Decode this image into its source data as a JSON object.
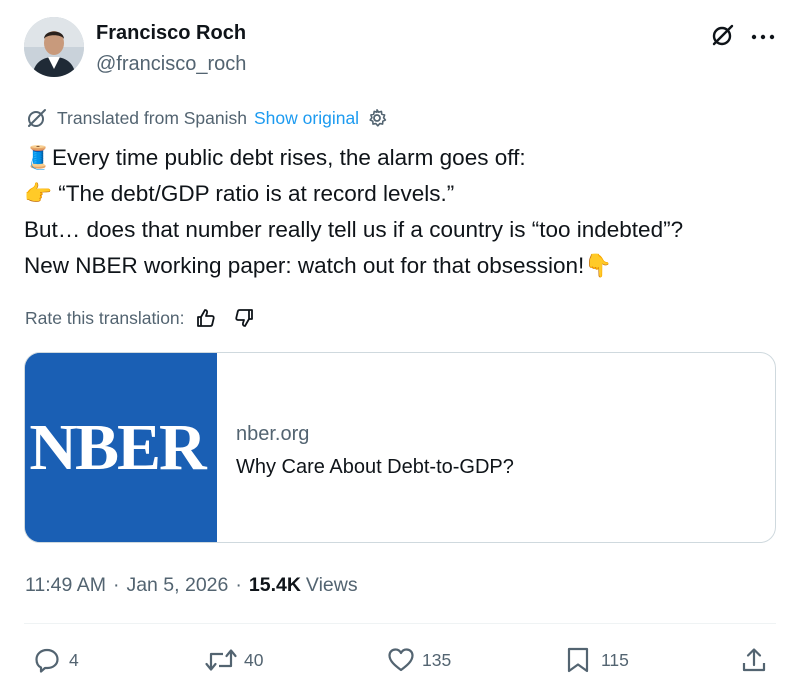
{
  "author": {
    "name": "Francisco Roch",
    "handle": "@francisco_roch"
  },
  "header_icons": [
    "grok-icon",
    "more-icon"
  ],
  "translation": {
    "label": "Translated from Spanish",
    "show_original": "Show original"
  },
  "tweet": {
    "lines": [
      {
        "emoji": "🧵",
        "text": "Every time public debt rises, the alarm goes off:"
      },
      {
        "emoji": "👉",
        "text": " “The debt/GDP ratio is at record levels.”"
      },
      {
        "text": "But… does that number really tell us if a country is “too indebted”?"
      },
      {
        "text": "New NBER working paper: watch out for that obsession!",
        "emoji_after": "👇"
      }
    ]
  },
  "rate": {
    "label": "Rate this translation:"
  },
  "card": {
    "logo_text": "NBER",
    "domain": "nber.org",
    "title": "Why Care About Debt-to-GDP?"
  },
  "meta": {
    "time": "11:49 AM",
    "sep1": "·",
    "date": "Jan 5, 2026",
    "sep2": "·",
    "views_count": "15.4K",
    "views_label": "Views"
  },
  "actions": {
    "replies": "4",
    "reposts": "40",
    "likes": "135",
    "bookmarks": "115"
  },
  "colors": {
    "accent": "#1d9bf0",
    "secondary_text": "#536471",
    "card_brand": "#1a5fb4"
  }
}
